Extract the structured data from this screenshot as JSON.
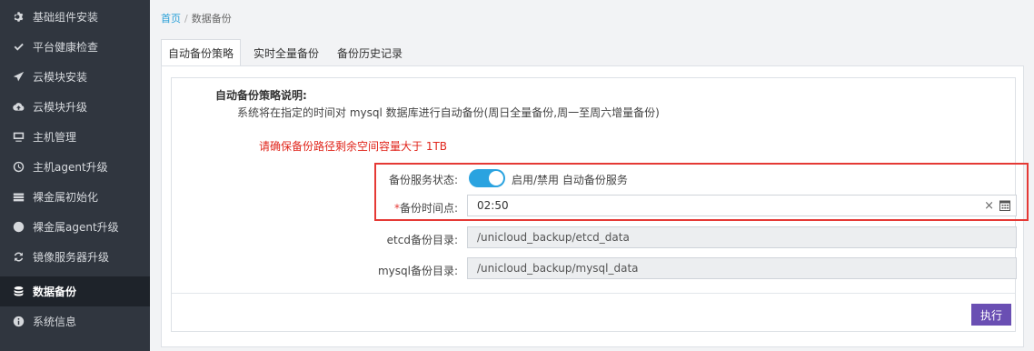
{
  "sidebar": {
    "items": [
      {
        "label": "基础组件安装",
        "icon": "gear-icon"
      },
      {
        "label": "平台健康检查",
        "icon": "check-icon"
      },
      {
        "label": "云模块安装",
        "icon": "send-icon"
      },
      {
        "label": "云模块升级",
        "icon": "cloud-upload-icon"
      },
      {
        "label": "主机管理",
        "icon": "monitor-icon"
      },
      {
        "label": "主机agent升级",
        "icon": "clock-icon"
      },
      {
        "label": "裸金属初始化",
        "icon": "server-icon"
      },
      {
        "label": "裸金属agent升级",
        "icon": "arrow-circle-up-icon"
      },
      {
        "label": "镜像服务器升级",
        "icon": "refresh-icon"
      },
      {
        "label": "数据备份",
        "icon": "database-icon",
        "active": true
      },
      {
        "label": "系统信息",
        "icon": "info-icon"
      }
    ]
  },
  "breadcrumb": {
    "home": "首页",
    "separator": "/",
    "current": "数据备份"
  },
  "tabs": [
    {
      "label": "自动备份策略",
      "active": true
    },
    {
      "label": "实时全量备份"
    },
    {
      "label": "备份历史记录"
    }
  ],
  "policy": {
    "title": "自动备份策略说明:",
    "description": "系统将在指定的时间对 mysql 数据库进行自动备份(周日全量备份,周一至周六增量备份)",
    "warning": "请确保备份路径剩余空间容量大于 1TB"
  },
  "form": {
    "status_label": "备份服务状态:",
    "status_on": true,
    "status_text": "启用/禁用 自动备份服务",
    "required_mark": "*",
    "time_label": "备份时间点:",
    "time_value": "02:50",
    "clear_glyph": "×",
    "etcd_label": "etcd备份目录:",
    "etcd_value": "/unicloud_backup/etcd_data",
    "mysql_label": "mysql备份目录:",
    "mysql_value": "/unicloud_backup/mysql_data"
  },
  "execute_label": "执行",
  "colors": {
    "sidebar_bg": "#30363f",
    "sidebar_active": "#1e232a",
    "toggle_on": "#2aa3e0",
    "warning": "#e0261c",
    "highlight_border": "#e53935",
    "primary_button": "#6a4fb3",
    "link": "#2aa0d8"
  }
}
